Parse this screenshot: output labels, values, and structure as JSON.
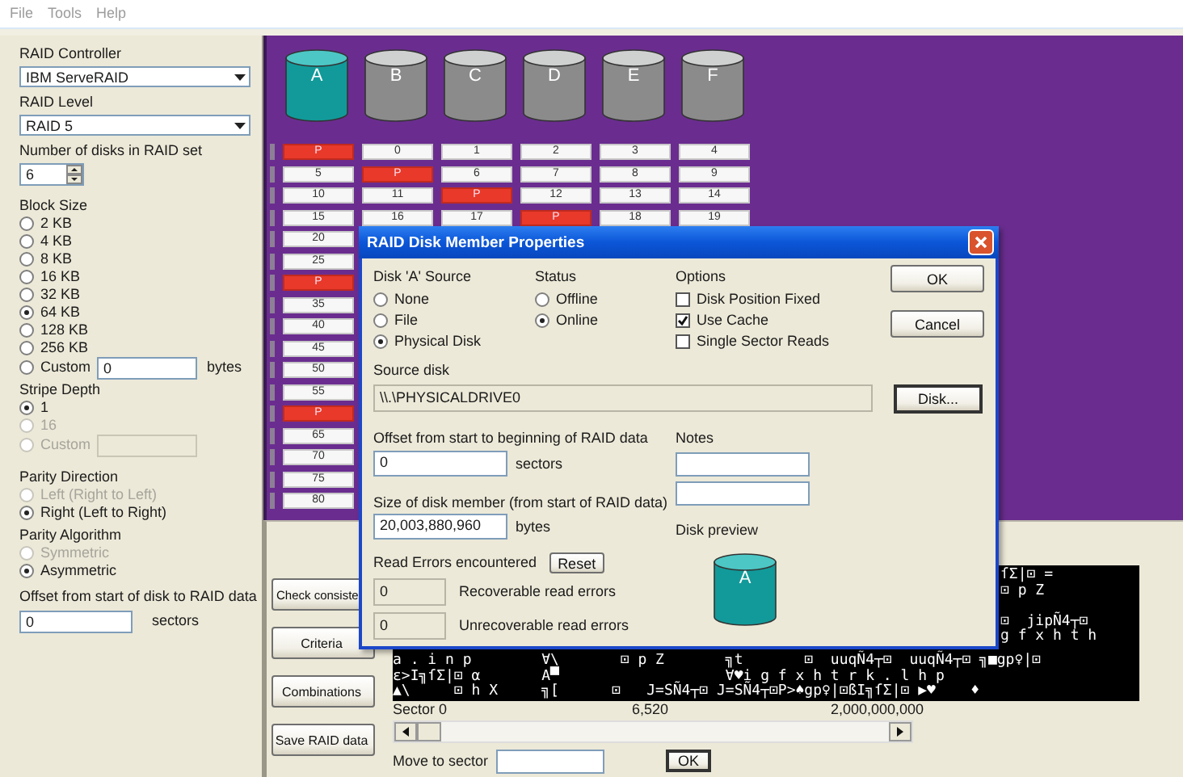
{
  "menu": [
    {
      "label": "File"
    },
    {
      "label": "Tools"
    },
    {
      "label": "Help"
    }
  ],
  "sidebar": {
    "controller": {
      "label": "RAID Controller",
      "value": "IBM ServeRAID"
    },
    "level": {
      "label": "RAID Level",
      "value": "RAID 5"
    },
    "disk_count": {
      "label": "Number of disks in RAID set",
      "value": "6"
    },
    "block_size": {
      "label": "Block Size",
      "custom_value": "0",
      "unit": "bytes",
      "options": [
        {
          "label": "2 KB",
          "selected": false,
          "disabled": false,
          "kind": "plain"
        },
        {
          "label": "4 KB",
          "selected": false,
          "disabled": false,
          "kind": "plain"
        },
        {
          "label": "8 KB",
          "selected": false,
          "disabled": false,
          "kind": "plain"
        },
        {
          "label": "16 KB",
          "selected": false,
          "disabled": false,
          "kind": "plain"
        },
        {
          "label": "32 KB",
          "selected": false,
          "disabled": false,
          "kind": "plain"
        },
        {
          "label": "64 KB",
          "selected": true,
          "disabled": false,
          "kind": "plain"
        },
        {
          "label": "128 KB",
          "selected": false,
          "disabled": false,
          "kind": "plain"
        },
        {
          "label": "256 KB",
          "selected": false,
          "disabled": false,
          "kind": "plain"
        },
        {
          "label": "Custom",
          "selected": false,
          "disabled": false,
          "kind": "custom"
        }
      ]
    },
    "stripe_depth": {
      "label": "Stripe Depth",
      "options": [
        {
          "label": "1",
          "selected": true,
          "disabled": false,
          "kind": "plain"
        },
        {
          "label": "16",
          "selected": false,
          "disabled": true,
          "kind": "plain"
        },
        {
          "label": "Custom",
          "selected": false,
          "disabled": true,
          "kind": "custom"
        }
      ]
    },
    "parity_direction": {
      "label": "Parity Direction",
      "options": [
        {
          "label": "Left (Right to Left)",
          "selected": false,
          "disabled": true
        },
        {
          "label": "Right (Left to Right)",
          "selected": true,
          "disabled": false
        }
      ]
    },
    "parity_algorithm": {
      "label": "Parity Algorithm",
      "options": [
        {
          "label": "Symmetric",
          "selected": false,
          "disabled": true
        },
        {
          "label": "Asymmetric",
          "selected": true,
          "disabled": false
        }
      ]
    },
    "offset": {
      "label": "Offset from start of disk to RAID data",
      "value": "0",
      "unit": "sectors"
    }
  },
  "disks": [
    {
      "label": "A",
      "selected": true
    },
    {
      "label": "B",
      "selected": false
    },
    {
      "label": "C",
      "selected": false
    },
    {
      "label": "D",
      "selected": false
    },
    {
      "label": "E",
      "selected": false
    },
    {
      "label": "F",
      "selected": false
    }
  ],
  "stripes": [
    {
      "cells": [
        {
          "text": "P",
          "parity": true
        },
        {
          "text": "0",
          "parity": false
        },
        {
          "text": "1",
          "parity": false
        },
        {
          "text": "2",
          "parity": false
        },
        {
          "text": "3",
          "parity": false
        },
        {
          "text": "4",
          "parity": false
        }
      ]
    },
    {
      "cells": [
        {
          "text": "5",
          "parity": false
        },
        {
          "text": "P",
          "parity": true
        },
        {
          "text": "6",
          "parity": false
        },
        {
          "text": "7",
          "parity": false
        },
        {
          "text": "8",
          "parity": false
        },
        {
          "text": "9",
          "parity": false
        }
      ]
    },
    {
      "cells": [
        {
          "text": "10",
          "parity": false
        },
        {
          "text": "11",
          "parity": false
        },
        {
          "text": "P",
          "parity": true
        },
        {
          "text": "12",
          "parity": false
        },
        {
          "text": "13",
          "parity": false
        },
        {
          "text": "14",
          "parity": false
        }
      ]
    },
    {
      "cells": [
        {
          "text": "15",
          "parity": false
        },
        {
          "text": "16",
          "parity": false
        },
        {
          "text": "17",
          "parity": false
        },
        {
          "text": "P",
          "parity": true
        },
        {
          "text": "18",
          "parity": false
        },
        {
          "text": "19",
          "parity": false
        }
      ]
    },
    {
      "cells": [
        {
          "text": "20",
          "parity": false
        }
      ]
    },
    {
      "cells": [
        {
          "text": "25",
          "parity": false
        }
      ]
    },
    {
      "cells": [
        {
          "text": "P",
          "parity": true
        }
      ]
    },
    {
      "cells": [
        {
          "text": "35",
          "parity": false
        }
      ]
    },
    {
      "cells": [
        {
          "text": "40",
          "parity": false
        }
      ]
    },
    {
      "cells": [
        {
          "text": "45",
          "parity": false
        }
      ]
    },
    {
      "cells": [
        {
          "text": "50",
          "parity": false
        }
      ]
    },
    {
      "cells": [
        {
          "text": "55",
          "parity": false
        }
      ]
    },
    {
      "cells": [
        {
          "text": "P",
          "parity": true
        }
      ]
    },
    {
      "cells": [
        {
          "text": "65",
          "parity": false
        }
      ]
    },
    {
      "cells": [
        {
          "text": "70",
          "parity": false
        }
      ]
    },
    {
      "cells": [
        {
          "text": "75",
          "parity": false
        }
      ]
    },
    {
      "cells": [
        {
          "text": "80",
          "parity": false
        }
      ]
    }
  ],
  "lower": {
    "buttons": [
      {
        "label": "Check consiste"
      },
      {
        "label": "Criteria"
      },
      {
        "label": "Combinations"
      },
      {
        "label": "Save RAID data"
      }
    ],
    "hex_view": {
      "right_lines": [
        "ſΣ|⊡ =",
        "⊡ p Z",
        "⊡  jipÑ4┬⊡",
        "g f x h t h"
      ],
      "lines": [
        "a . i n p        ∀\\       ⊡ p Z       ╗t       ⊡  uuqÑ4┬⊡  uuqÑ4┬⊡ ╗■gp♀|⊡",
        "ε>I╗ſΣ|⊡ α       A▀                   ∀♥i g f x h t r k . l h p",
        "▲\\     ⊡ h X     ╗[      ⊡   J=SÑ4┬⊡ J=SÑ4┬⊡P>♠gp♀|⊡ßI╗ſΣ|⊡ ▶♥    ♦"
      ]
    },
    "sector_labels": [
      "Sector 0",
      "6,520",
      "2,000,000,000"
    ],
    "move_to": {
      "label": "Move to sector",
      "button": "OK"
    }
  },
  "dialog": {
    "title": "RAID Disk Member Properties",
    "source": {
      "label": "Disk 'A' Source",
      "options": [
        {
          "label": "None",
          "selected": false
        },
        {
          "label": "File",
          "selected": false
        },
        {
          "label": "Physical Disk",
          "selected": true
        }
      ]
    },
    "status": {
      "label": "Status",
      "options": [
        {
          "label": "Offline",
          "selected": false
        },
        {
          "label": "Online",
          "selected": true
        }
      ]
    },
    "options": {
      "label": "Options",
      "items": [
        {
          "label": "Disk Position Fixed",
          "checked": false
        },
        {
          "label": "Use Cache",
          "checked": true
        },
        {
          "label": "Single Sector Reads",
          "checked": false
        }
      ]
    },
    "buttons": [
      {
        "label": "OK"
      },
      {
        "label": "Cancel"
      }
    ],
    "source_disk": {
      "label": "Source disk",
      "value": "\\\\.\\PHYSICALDRIVE0",
      "button": "Disk..."
    },
    "offset": {
      "label": "Offset from start to beginning of RAID data",
      "value": "0",
      "unit": "sectors"
    },
    "size": {
      "label": "Size of disk member (from start of RAID data)",
      "value": "20,003,880,960",
      "unit": "bytes"
    },
    "notes": {
      "label": "Notes"
    },
    "preview": {
      "label": "Disk preview",
      "disk": "A"
    },
    "read_errors": {
      "label": "Read Errors encountered",
      "button": "Reset",
      "recoverable": {
        "value": "0",
        "label": "Recoverable read errors"
      },
      "unrecoverable": {
        "value": "0",
        "label": "Unrecoverable read errors"
      }
    }
  }
}
